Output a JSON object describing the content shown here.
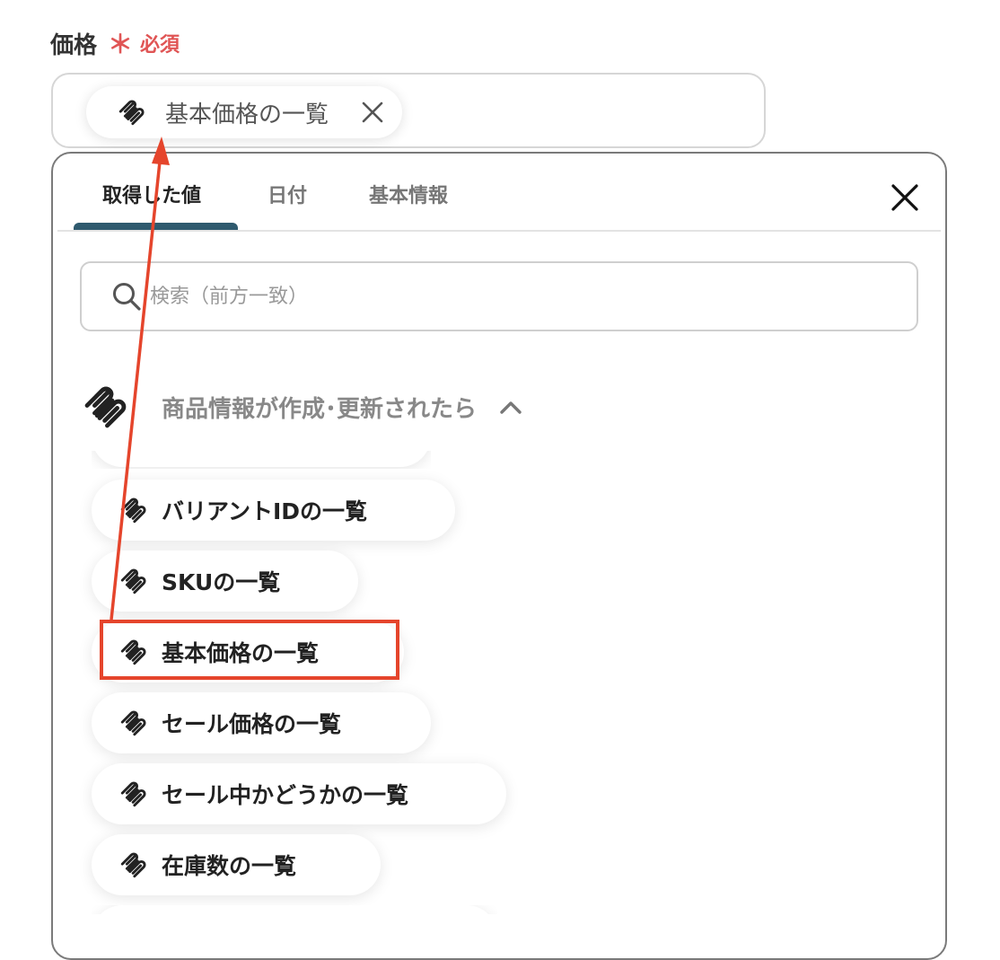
{
  "field": {
    "label": "価格",
    "required_mark": "＊",
    "required_text": "必須",
    "selected_chip": "基本価格の一覧"
  },
  "panel": {
    "tabs": [
      {
        "label": "取得した値",
        "active": true
      },
      {
        "label": "日付",
        "active": false
      },
      {
        "label": "基本情報",
        "active": false
      }
    ],
    "search_placeholder": "検索（前方一致）",
    "section_title": "商品情報が作成･更新されたら",
    "items": [
      {
        "label": "バリアントIDの一覧"
      },
      {
        "label": "SKUの一覧"
      },
      {
        "label": "基本価格の一覧",
        "highlighted": true
      },
      {
        "label": "セール価格の一覧"
      },
      {
        "label": "セール中かどうかの一覧"
      },
      {
        "label": "在庫数の一覧"
      }
    ]
  },
  "icons": {
    "chip": "squarespace-logo-icon",
    "chip_remove": "close-icon",
    "panel_close": "close-icon",
    "search": "search-icon",
    "section": "squarespace-logo-icon",
    "section_toggle": "chevron-up-icon"
  },
  "colors": {
    "required": "#e05555",
    "tab_underline": "#2f5a6e",
    "annotation": "#e5452c"
  }
}
